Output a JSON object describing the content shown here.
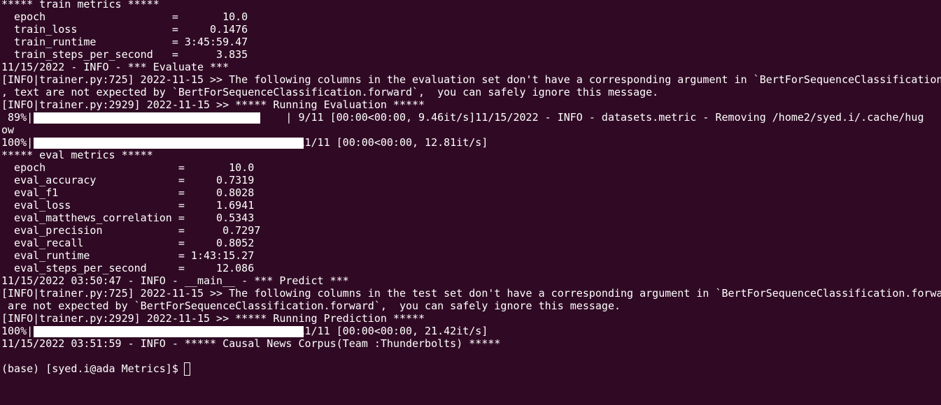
{
  "terminal": {
    "lines": [
      "***** train metrics *****",
      "  epoch                    =       10.0",
      "  train_loss               =     0.1476",
      "  train_runtime            = 3:45:59.47",
      "  train_steps_per_second   =      3.835",
      "11/15/2022 - INFO - *** Evaluate ***",
      "[INFO|trainer.py:725] 2022-11-15 >> The following columns in the evaluation set don't have a corresponding argument in `BertForSequenceClassification",
      ", text are not expected by `BertForSequenceClassification.forward`,  you can safely ignore this message.",
      "[INFO|trainer.py:2929] 2022-11-15 >> ***** Running Evaluation *****",
      " 89%|                                        | 9/11 [00:00<00:00, 9.46it/s]11/15/2022 - INFO - datasets.metric - Removing /home2/syed.i/.cache/hug",
      "ow",
      "100%|                                        | 11/11 [00:00<00:00, 12.81it/s]",
      "***** eval metrics *****",
      "  epoch                     =       10.0",
      "  eval_accuracy             =     0.7319",
      "  eval_f1                   =     0.8028",
      "  eval_loss                 =     1.6941",
      "  eval_matthews_correlation =     0.5343",
      "  eval_precision            =      0.7297",
      "  eval_recall               =     0.8052",
      "  eval_runtime              = 1:43:15.27",
      "  eval_steps_per_second     =     12.086",
      "11/15/2022 03:50:47 - INFO - __main__ - *** Predict ***",
      "[INFO|trainer.py:725] 2022-11-15 >> The following columns in the test set don't have a corresponding argument in `BertForSequenceClassification.forwar",
      " are not expected by `BertForSequenceClassification.forward`,  you can safely ignore this message.",
      "[INFO|trainer.py:2929] 2022-11-15 >> ***** Running Prediction *****",
      "100%|                                        | 11/11 [00:00<00:00, 21.42it/s]",
      "11/15/2022 03:51:59 - INFO - ***** Causal News Corpus(Team :Thunderbolts) *****",
      "",
      "(base) [syed.i@ada Metrics]$ "
    ],
    "progress_bars": [
      {
        "line": 9,
        "fraction": 0.89
      },
      {
        "line": 11,
        "fraction": 1.0
      },
      {
        "line": 26,
        "fraction": 1.0
      }
    ],
    "colors": {
      "background": "#300a24",
      "foreground": "#ffffff"
    }
  }
}
